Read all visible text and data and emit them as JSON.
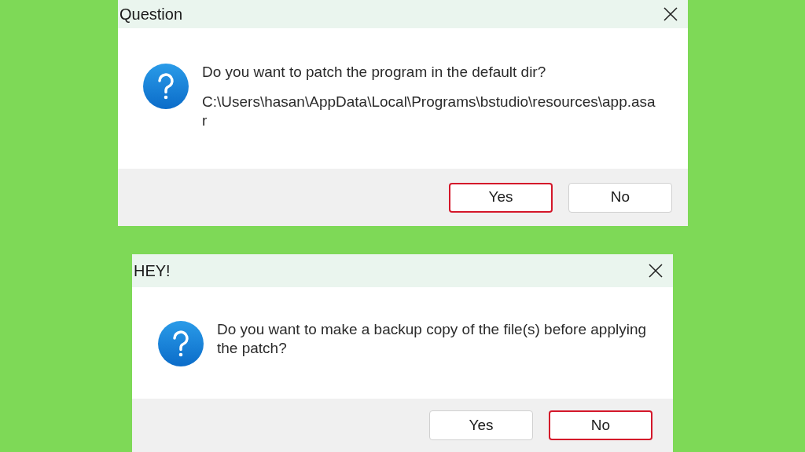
{
  "dialogs": [
    {
      "title": "Question",
      "messages": [
        "Do you want to patch the program in the default dir?",
        "C:\\Users\\hasan\\AppData\\Local\\Programs\\bstudio\\resources\\app.asar"
      ],
      "buttons": [
        {
          "label": "Yes",
          "selected": true
        },
        {
          "label": "No",
          "selected": false
        }
      ]
    },
    {
      "title": "HEY!",
      "messages": [
        "Do you want to make a backup copy of the file(s) before applying the patch?"
      ],
      "buttons": [
        {
          "label": "Yes",
          "selected": false
        },
        {
          "label": "No",
          "selected": true
        }
      ]
    }
  ]
}
